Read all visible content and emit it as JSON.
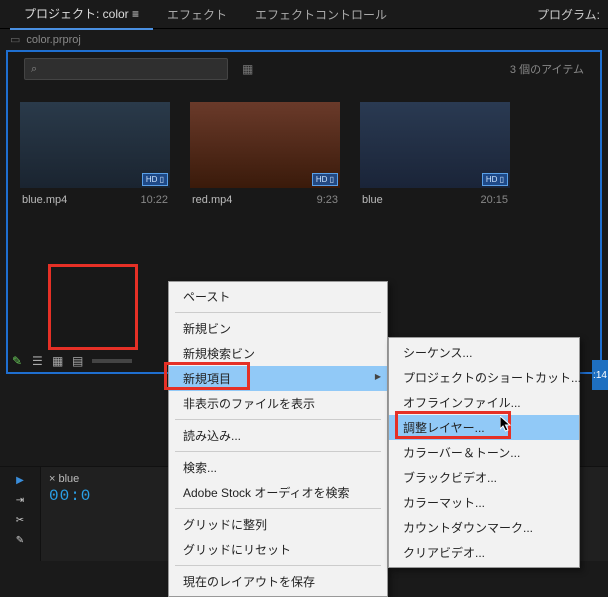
{
  "tabs": {
    "project": "プロジェクト: color",
    "effect": "エフェクト",
    "effect_control": "エフェクトコントロール"
  },
  "program_label": "プログラム:",
  "crumb": {
    "filename": "color.prproj"
  },
  "search": {
    "placeholder": ""
  },
  "item_count": "3 個のアイテム",
  "thumbs": {
    "blue1": {
      "name": "blue.mp4",
      "dur": "10:22"
    },
    "red": {
      "name": "red.mp4",
      "dur": "9:23"
    },
    "blue2": {
      "name": "blue",
      "dur": "20:15"
    }
  },
  "timeline": {
    "tab": "blue",
    "time": "00:0"
  },
  "context1": {
    "paste": "ペースト",
    "new_bin": "新規ビン",
    "new_search_bin": "新規検索ビン",
    "new_item": "新規項目",
    "show_hidden": "非表示のファイルを表示",
    "import": "読み込み...",
    "search": "検索...",
    "adobe_stock": "Adobe Stock オーディオを検索",
    "align_grid": "グリッドに整列",
    "reset_grid": "グリッドにリセット",
    "save_layout": "現在のレイアウトを保存"
  },
  "context2": {
    "sequence": "シーケンス...",
    "project_shortcut": "プロジェクトのショートカット...",
    "offline_file": "オフラインファイル...",
    "adjustment_layer": "調整レイヤー...",
    "color_bars": "カラーバー＆トーン...",
    "black_video": "ブラックビデオ...",
    "color_mat": "カラーマット...",
    "countdown": "カウントダウンマーク...",
    "clear_video": "クリアビデオ..."
  },
  "side_badge": ":14"
}
